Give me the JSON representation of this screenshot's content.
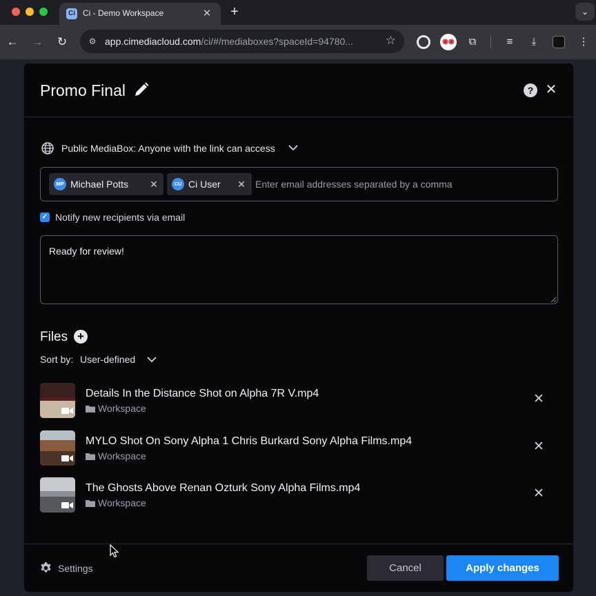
{
  "browser": {
    "tab_title": "Ci - Demo Workspace",
    "tab_favicon": "Ci",
    "url_host": "app.cimediacloud.com",
    "url_path": "/ci/#/mediaboxes?spaceId=94780...",
    "icons": [
      "back-icon",
      "forward-icon",
      "reload-icon",
      "site-settings-icon",
      "bookmark-star-icon",
      "extension-icon",
      "downloads-icon",
      "chrome-menu-icon"
    ]
  },
  "modal": {
    "title": "Promo Final",
    "access_text": "Public MediaBox: Anyone with the link can access",
    "recipients": [
      {
        "initials": "MP",
        "name": "Michael Potts"
      },
      {
        "initials": "CU",
        "name": "Ci User"
      }
    ],
    "email_placeholder": "Enter email addresses separated by a comma",
    "notify_label": "Notify new recipients via email",
    "notify_checked": true,
    "message": "Ready for review!",
    "files_heading": "Files",
    "sort_label": "Sort by:",
    "sort_value": "User-defined",
    "files": [
      {
        "name": "Details In the Distance Shot on Alpha 7R V.mp4",
        "location": "Workspace"
      },
      {
        "name": "MYLO Shot On Sony Alpha 1 Chris Burkard Sony Alpha Films.mp4",
        "location": "Workspace"
      },
      {
        "name": "The Ghosts Above Renan Ozturk Sony Alpha Films.mp4",
        "location": "Workspace"
      }
    ],
    "settings_label": "Settings",
    "cancel_label": "Cancel",
    "apply_label": "Apply changes"
  },
  "colors": {
    "accent": "#1c86f2",
    "modal_bg": "#08080a",
    "avatar": "#3d8ef0"
  }
}
